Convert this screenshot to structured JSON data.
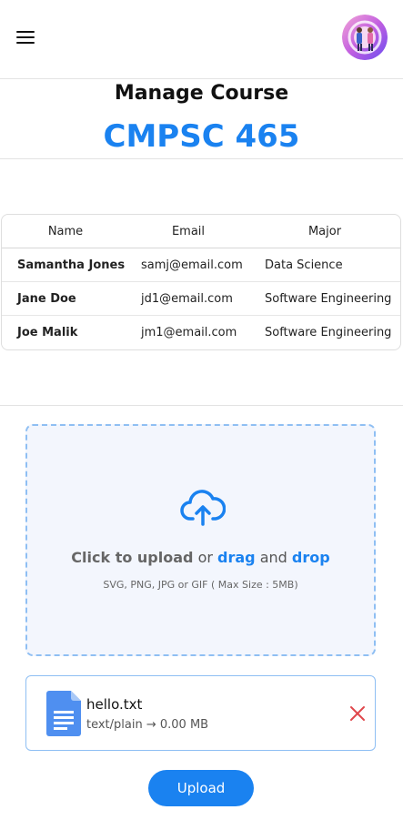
{
  "header": {
    "menu_icon": "hamburger-menu-icon",
    "avatar_icon": "user-avatar"
  },
  "page": {
    "title": "Manage Course",
    "course_code": "CMPSC 465"
  },
  "table": {
    "columns": [
      "Name",
      "Email",
      "Major"
    ],
    "rows": [
      {
        "name": "Samantha Jones",
        "email": "samj@email.com",
        "major": "Data Science"
      },
      {
        "name": "Jane Doe",
        "email": "jd1@email.com",
        "major": "Software Engineering"
      },
      {
        "name": "Joe Malik",
        "email": "jm1@email.com",
        "major": "Software Engineering"
      }
    ]
  },
  "dropzone": {
    "icon": "cloud-upload-icon",
    "click_text": "Click to upload",
    "or_text": "or",
    "drag_text": "drag",
    "and_text": "and",
    "drop_text": "drop",
    "hint": "SVG, PNG, JPG or GIF ( Max Size : 5MB)"
  },
  "file": {
    "icon": "document-file-icon",
    "name": "hello.txt",
    "meta": "text/plain → 0.00 MB",
    "remove_icon": "close-icon"
  },
  "actions": {
    "upload_label": "Upload"
  },
  "colors": {
    "accent": "#1a82f0",
    "dropzone_bg": "#f3f6fd",
    "dropzone_border": "#8fbff3",
    "remove": "#e0474c"
  }
}
